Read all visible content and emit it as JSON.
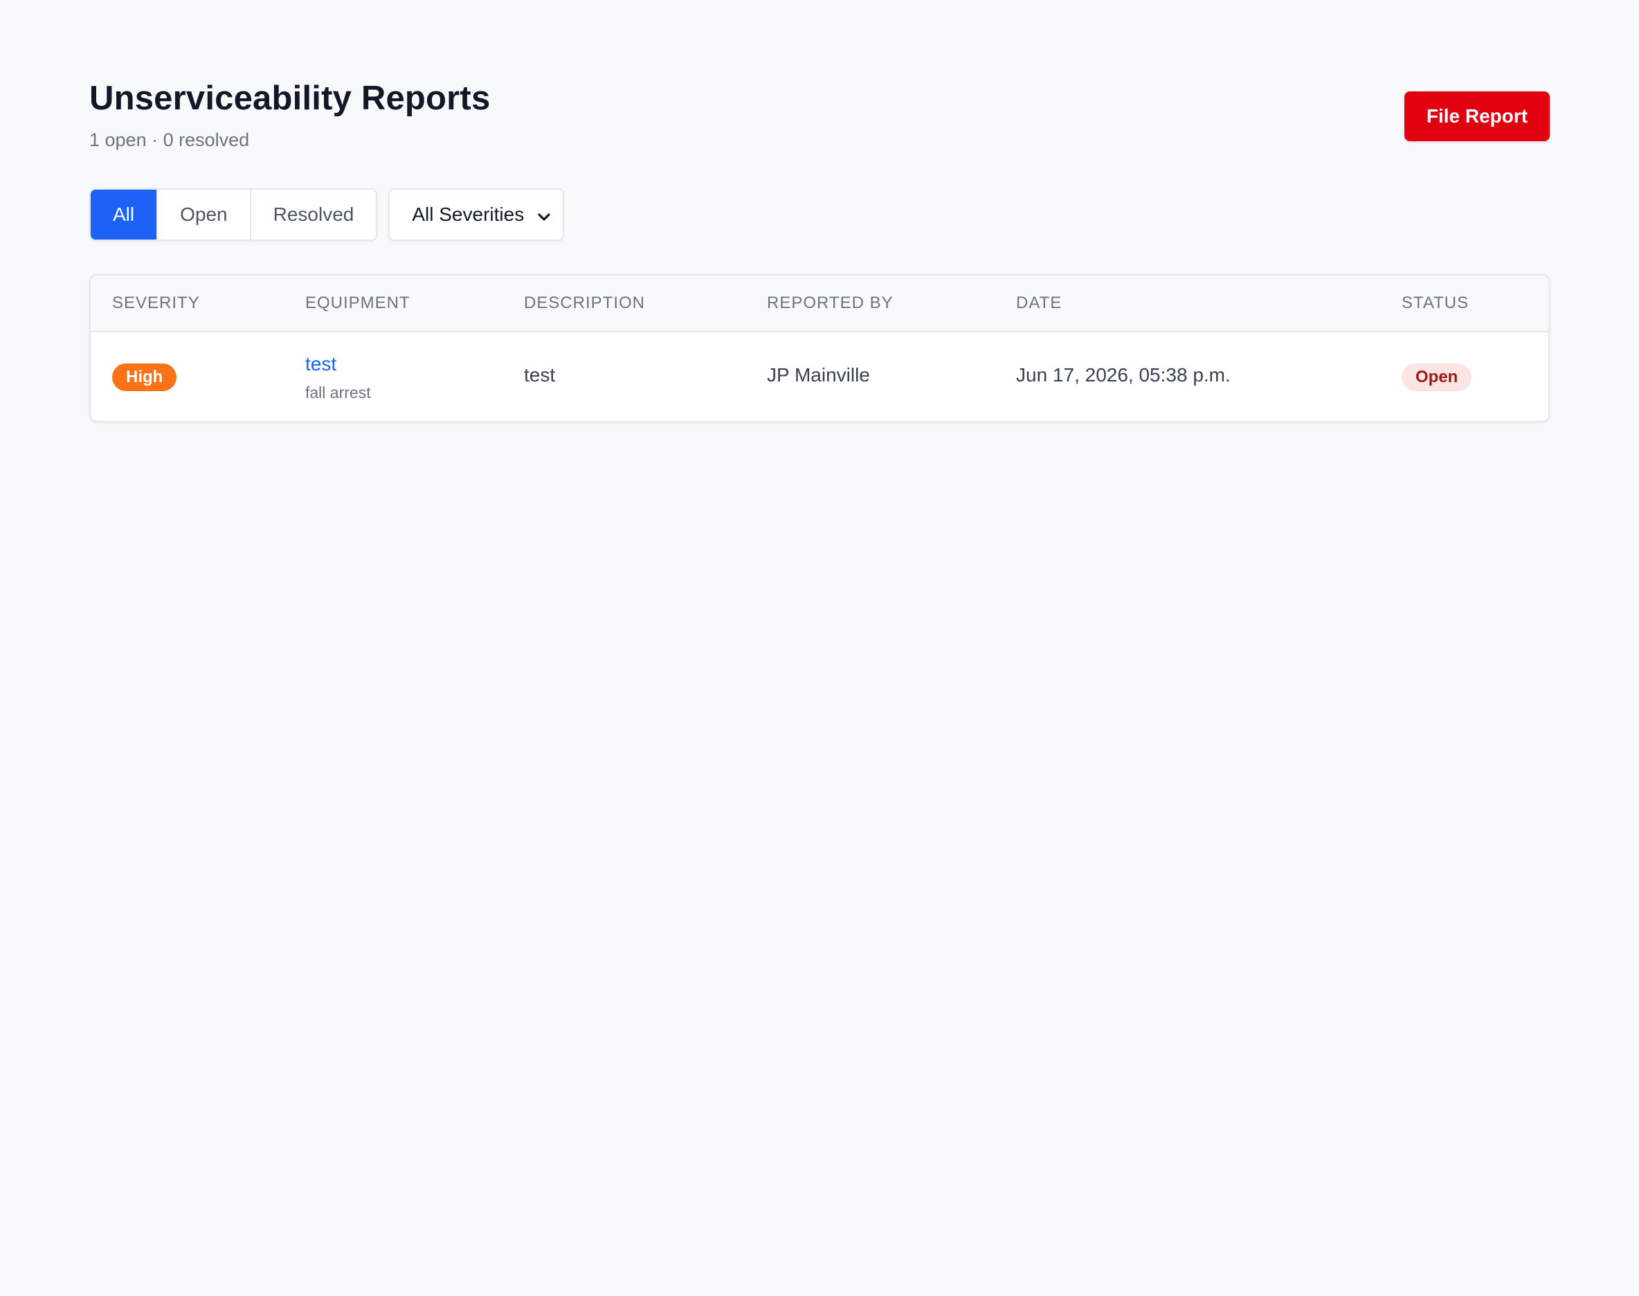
{
  "header": {
    "title": "Unserviceability Reports",
    "summary": "1 open · 0 resolved",
    "file_report_label": "File Report"
  },
  "filters": {
    "status_tabs": [
      "All",
      "Open",
      "Resolved"
    ],
    "active_status": "All",
    "severity_select": {
      "selected": "All Severities",
      "icon": "chevron-down-icon"
    }
  },
  "table": {
    "columns": [
      "SEVERITY",
      "EQUIPMENT",
      "DESCRIPTION",
      "REPORTED BY",
      "DATE",
      "STATUS"
    ],
    "rows": [
      {
        "severity": "High",
        "equipment_name": "test",
        "equipment_type": "fall arrest",
        "description": "test",
        "reported_by": "JP Mainville",
        "date": "Jun 17, 2026, 05:38 p.m.",
        "status": "Open"
      }
    ]
  },
  "colors": {
    "primary": "#1c62f7",
    "danger": "#e00010",
    "severity_high": "#f97316",
    "status_open_bg": "#fde4e4",
    "status_open_text": "#991b1b",
    "page_bg": "#f8f9fb"
  }
}
